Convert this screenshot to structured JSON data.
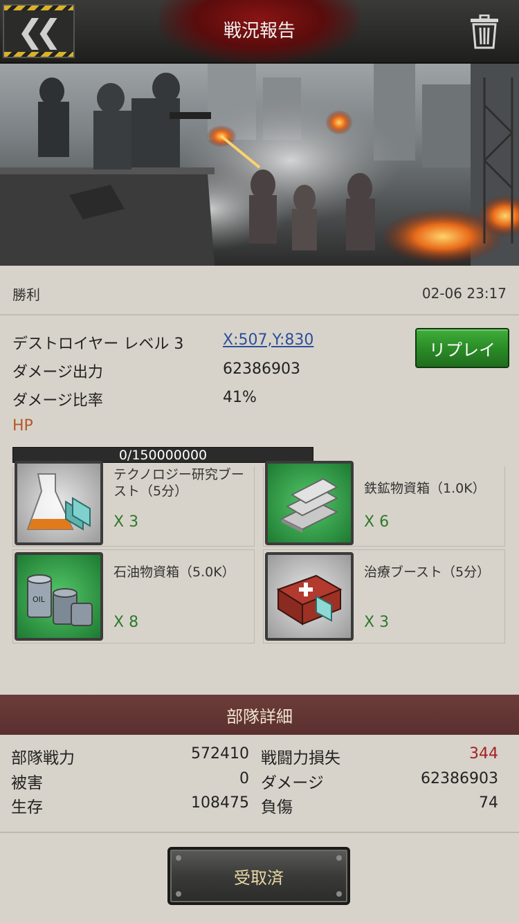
{
  "header": {
    "title": "戦況報告",
    "back_icon": "double-chevron-left-icon",
    "trash_icon": "trash-icon"
  },
  "result": {
    "label": "勝利",
    "timestamp": "02-06 23:17"
  },
  "target": {
    "name": "デストロイヤー レベル 3",
    "coords": "X:507,Y:830",
    "damage_label": "ダメージ出力",
    "damage_value": "62386903",
    "ratio_label": "ダメージ比率",
    "ratio_value": "41%",
    "hp_label": "HP",
    "hp_text": "0/150000000",
    "hp_fraction": 0.0
  },
  "replay_label": "リプレイ",
  "rewards": [
    {
      "name": "テクノロジー研究ブースト（5分）",
      "qty": "X 3",
      "icon": "research-flask-icon",
      "bg": "gray"
    },
    {
      "name": "鉄鉱物資箱（1.0K）",
      "qty": "X 6",
      "icon": "iron-ingots-icon",
      "bg": "green"
    },
    {
      "name": "石油物資箱（5.0K）",
      "qty": "X 8",
      "icon": "oil-barrels-icon",
      "bg": "green"
    },
    {
      "name": "治療ブースト（5分）",
      "qty": "X 3",
      "icon": "medical-kit-icon",
      "bg": "gray"
    }
  ],
  "unit": {
    "section_title": "部隊詳細",
    "power_label": "部隊戦力",
    "power_value": "572410",
    "loss_label": "戦闘力損失",
    "loss_value": "344",
    "damage_taken_label": "被害",
    "damage_taken_value": "0",
    "damage_label": "ダメージ",
    "damage_value": "62386903",
    "survive_label": "生存",
    "survive_value": "108475",
    "wounded_label": "負傷",
    "wounded_value": "74"
  },
  "claimed_label": "受取済",
  "colors": {
    "accent_green": "#2b8c27",
    "section_bar": "#5a302e",
    "loss_red": "#a12121",
    "hp_label": "#b4572a"
  }
}
